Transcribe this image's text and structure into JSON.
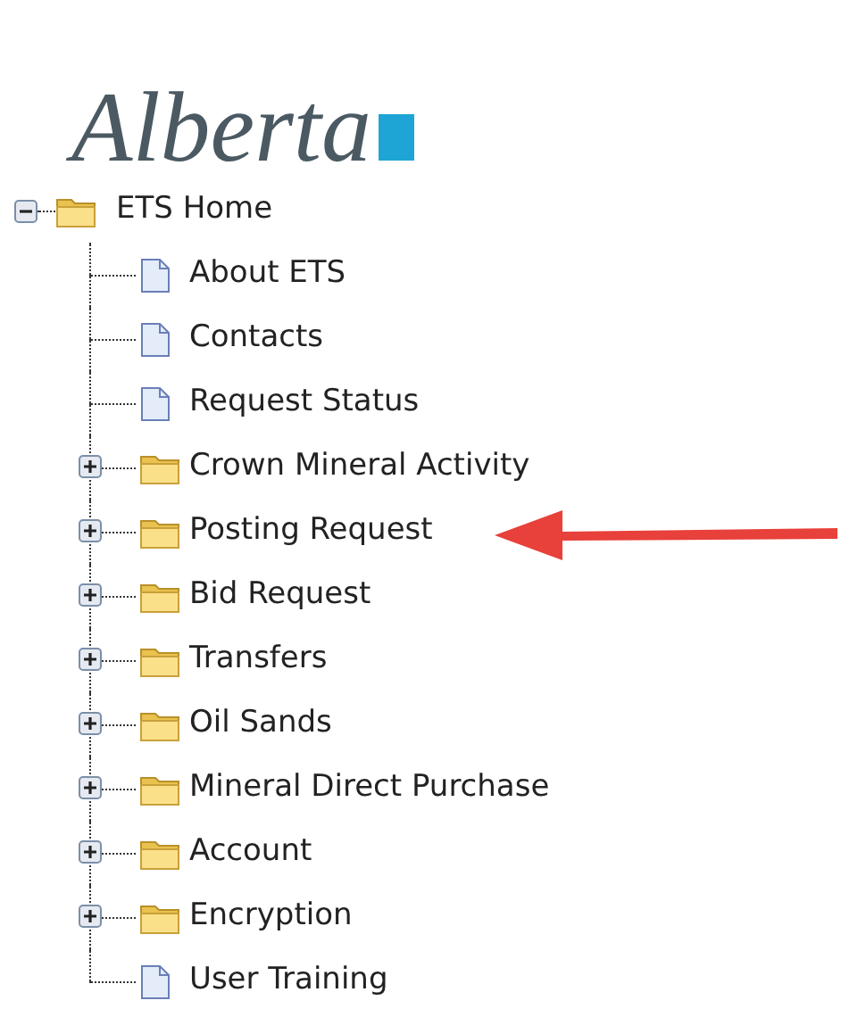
{
  "logo": {
    "text": "Alberta"
  },
  "tree": {
    "label": "ETS Home",
    "kind": "folder",
    "expanded": true,
    "children": [
      {
        "label": "About ETS",
        "kind": "page"
      },
      {
        "label": "Contacts",
        "kind": "page"
      },
      {
        "label": "Request Status",
        "kind": "page"
      },
      {
        "label": "Crown Mineral Activity",
        "kind": "folder",
        "expanded": false
      },
      {
        "label": "Posting Request",
        "kind": "folder",
        "expanded": false,
        "pointed_at": true
      },
      {
        "label": "Bid Request",
        "kind": "folder",
        "expanded": false
      },
      {
        "label": "Transfers",
        "kind": "folder",
        "expanded": false
      },
      {
        "label": "Oil Sands",
        "kind": "folder",
        "expanded": false
      },
      {
        "label": "Mineral Direct Purchase",
        "kind": "folder",
        "expanded": false
      },
      {
        "label": "Account",
        "kind": "folder",
        "expanded": false
      },
      {
        "label": "Encryption",
        "kind": "folder",
        "expanded": false
      },
      {
        "label": "User Training",
        "kind": "page"
      }
    ]
  }
}
